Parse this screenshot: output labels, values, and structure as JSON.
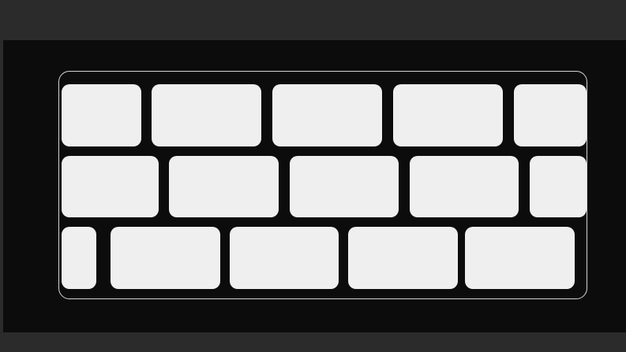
{
  "colors": {
    "chrome": "#2b2b2b",
    "canvas": "#0c0c0d",
    "tile": "#efefef",
    "frame_border": "#d6d6d6"
  },
  "grid": {
    "rows": [
      {
        "tiles": [
          "",
          "",
          "",
          "",
          ""
        ]
      },
      {
        "tiles": [
          "",
          "",
          "",
          "",
          ""
        ]
      },
      {
        "tiles": [
          "",
          "",
          "",
          "",
          ""
        ]
      }
    ]
  }
}
